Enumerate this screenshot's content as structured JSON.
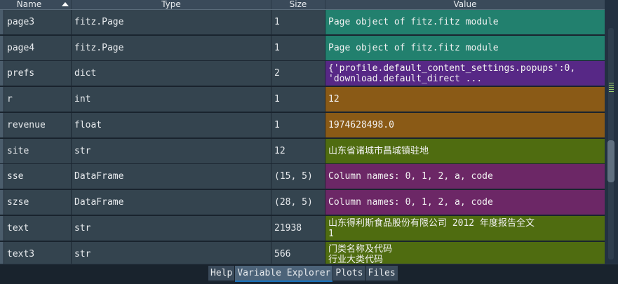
{
  "header": {
    "name": "Name",
    "type": "Type",
    "size": "Size",
    "value": "Value"
  },
  "rows": [
    {
      "name": "page3",
      "type": "fitz.Page",
      "size": "1",
      "value": [
        "Page object of fitz.fitz module"
      ],
      "color": "#22806e"
    },
    {
      "name": "page4",
      "type": "fitz.Page",
      "size": "1",
      "value": [
        "Page object of fitz.fitz module"
      ],
      "color": "#22806e"
    },
    {
      "name": "prefs",
      "type": "dict",
      "size": "2",
      "value": [
        "{'profile.default_content_settings.popups':0,",
        "'download.default_direct ..."
      ],
      "color": "#572886"
    },
    {
      "name": "r",
      "type": "int",
      "size": "1",
      "value": [
        "12"
      ],
      "color": "#8a5a16"
    },
    {
      "name": "revenue",
      "type": "float",
      "size": "1",
      "value": [
        "1974628498.0"
      ],
      "color": "#8a5a16"
    },
    {
      "name": "site",
      "type": "str",
      "size": "12",
      "value": [
        "山东省诸城市昌城镇驻地"
      ],
      "color": "#4f6c10"
    },
    {
      "name": "sse",
      "type": "DataFrame",
      "size": "(15, 5)",
      "value": [
        "Column names: 0, 1, 2, a, code"
      ],
      "color": "#6c2766"
    },
    {
      "name": "szse",
      "type": "DataFrame",
      "size": "(28, 5)",
      "value": [
        "Column names: 0, 1, 2, a, code"
      ],
      "color": "#6c2766"
    },
    {
      "name": "text",
      "type": "str",
      "size": "21938",
      "value": [
        "山东得利斯食品股份有限公司 2012 年度报告全文",
        "1"
      ],
      "color": "#4f6c10"
    },
    {
      "name": "text3",
      "type": "str",
      "size": "566",
      "value": [
        "门类名称及代码",
        "行业大类代码"
      ],
      "color": "#4f6c10"
    }
  ],
  "tabs": [
    {
      "label": "Help",
      "active": false
    },
    {
      "label": "Variable Explorer",
      "active": true
    },
    {
      "label": "Plots",
      "active": false
    },
    {
      "label": "Files",
      "active": false
    }
  ]
}
